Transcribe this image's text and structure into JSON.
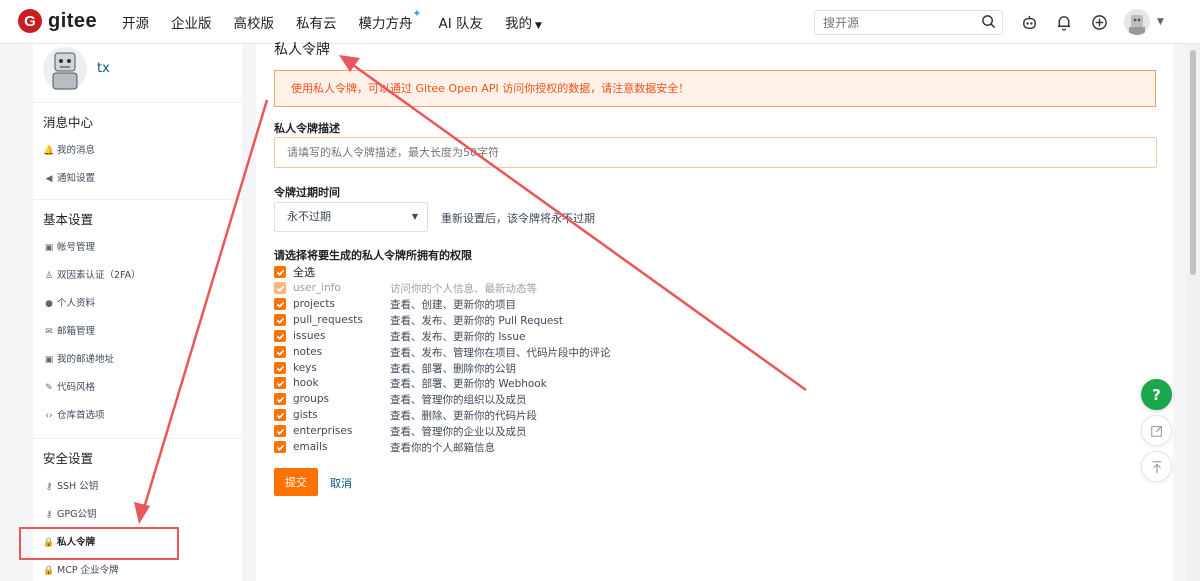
{
  "header": {
    "logo_text": "gitee",
    "nav": [
      "开源",
      "企业版",
      "高校版",
      "私有云",
      "模力方舟",
      "AI 队友",
      "我的"
    ],
    "search_placeholder": "搜开源"
  },
  "sidebar": {
    "username": "tx",
    "sections": [
      {
        "title": "消息中心",
        "items": [
          {
            "label": "我的消息",
            "icon": "bell-icon",
            "glyph": "🔔"
          },
          {
            "label": "通知设置",
            "icon": "speaker-icon",
            "glyph": "◀"
          }
        ]
      },
      {
        "title": "基本设置",
        "items": [
          {
            "label": "帐号管理",
            "icon": "id-card-icon",
            "glyph": "▣"
          },
          {
            "label": "双因素认证（2FA）",
            "icon": "user-shield-icon",
            "glyph": "♙"
          },
          {
            "label": "个人资料",
            "icon": "user-icon",
            "glyph": "●"
          },
          {
            "label": "邮箱管理",
            "icon": "mail-icon",
            "glyph": "✉"
          },
          {
            "label": "我的邮递地址",
            "icon": "address-icon",
            "glyph": "▣"
          },
          {
            "label": "代码风格",
            "icon": "brush-icon",
            "glyph": "✎"
          },
          {
            "label": "仓库首选项",
            "icon": "code-icon",
            "glyph": "‹›"
          }
        ]
      },
      {
        "title": "安全设置",
        "items": [
          {
            "label": "SSH 公钥",
            "icon": "key-icon",
            "glyph": "⚷"
          },
          {
            "label": "GPG公钥",
            "icon": "key-icon",
            "glyph": "⚷"
          },
          {
            "label": "私人令牌",
            "icon": "lock-icon",
            "glyph": "🔒",
            "active": true
          },
          {
            "label": "MCP 企业令牌",
            "icon": "lock-icon",
            "glyph": "🔒"
          }
        ]
      }
    ]
  },
  "main": {
    "title": "私人令牌",
    "warning": "使用私人令牌，可以通过 Gitee Open API 访问你授权的数据，请注意数据安全！",
    "desc_label": "私人令牌描述",
    "desc_placeholder": "请填写的私人令牌描述，最大长度为50字符",
    "expire_label": "令牌过期时间",
    "expire_value": "永不过期",
    "expire_hint": "重新设置后，该令牌将永不过期",
    "perm_label": "请选择将要生成的私人令牌所拥有的权限",
    "select_all": "全选",
    "permissions": [
      {
        "name": "user_info",
        "desc": "访问你的个人信息、最新动态等",
        "disabled": true
      },
      {
        "name": "projects",
        "desc": "查看、创建、更新你的项目"
      },
      {
        "name": "pull_requests",
        "desc": "查看、发布、更新你的 Pull Request"
      },
      {
        "name": "issues",
        "desc": "查看、发布、更新你的 Issue"
      },
      {
        "name": "notes",
        "desc": "查看、发布、管理你在项目、代码片段中的评论"
      },
      {
        "name": "keys",
        "desc": "查看、部署、删除你的公钥"
      },
      {
        "name": "hook",
        "desc": "查看、部署、更新你的 Webhook"
      },
      {
        "name": "groups",
        "desc": "查看、管理你的组织以及成员"
      },
      {
        "name": "gists",
        "desc": "查看、删除、更新你的代码片段"
      },
      {
        "name": "enterprises",
        "desc": "查看、管理你的企业以及成员"
      },
      {
        "name": "emails",
        "desc": "查看你的个人邮箱信息"
      }
    ],
    "submit": "提交",
    "cancel": "取消"
  },
  "floating": {
    "help": "?"
  },
  "colors": {
    "accent": "#fe7300",
    "brand": "#c71d23",
    "annotation": "#e8575a",
    "help": "#1aa64a"
  }
}
